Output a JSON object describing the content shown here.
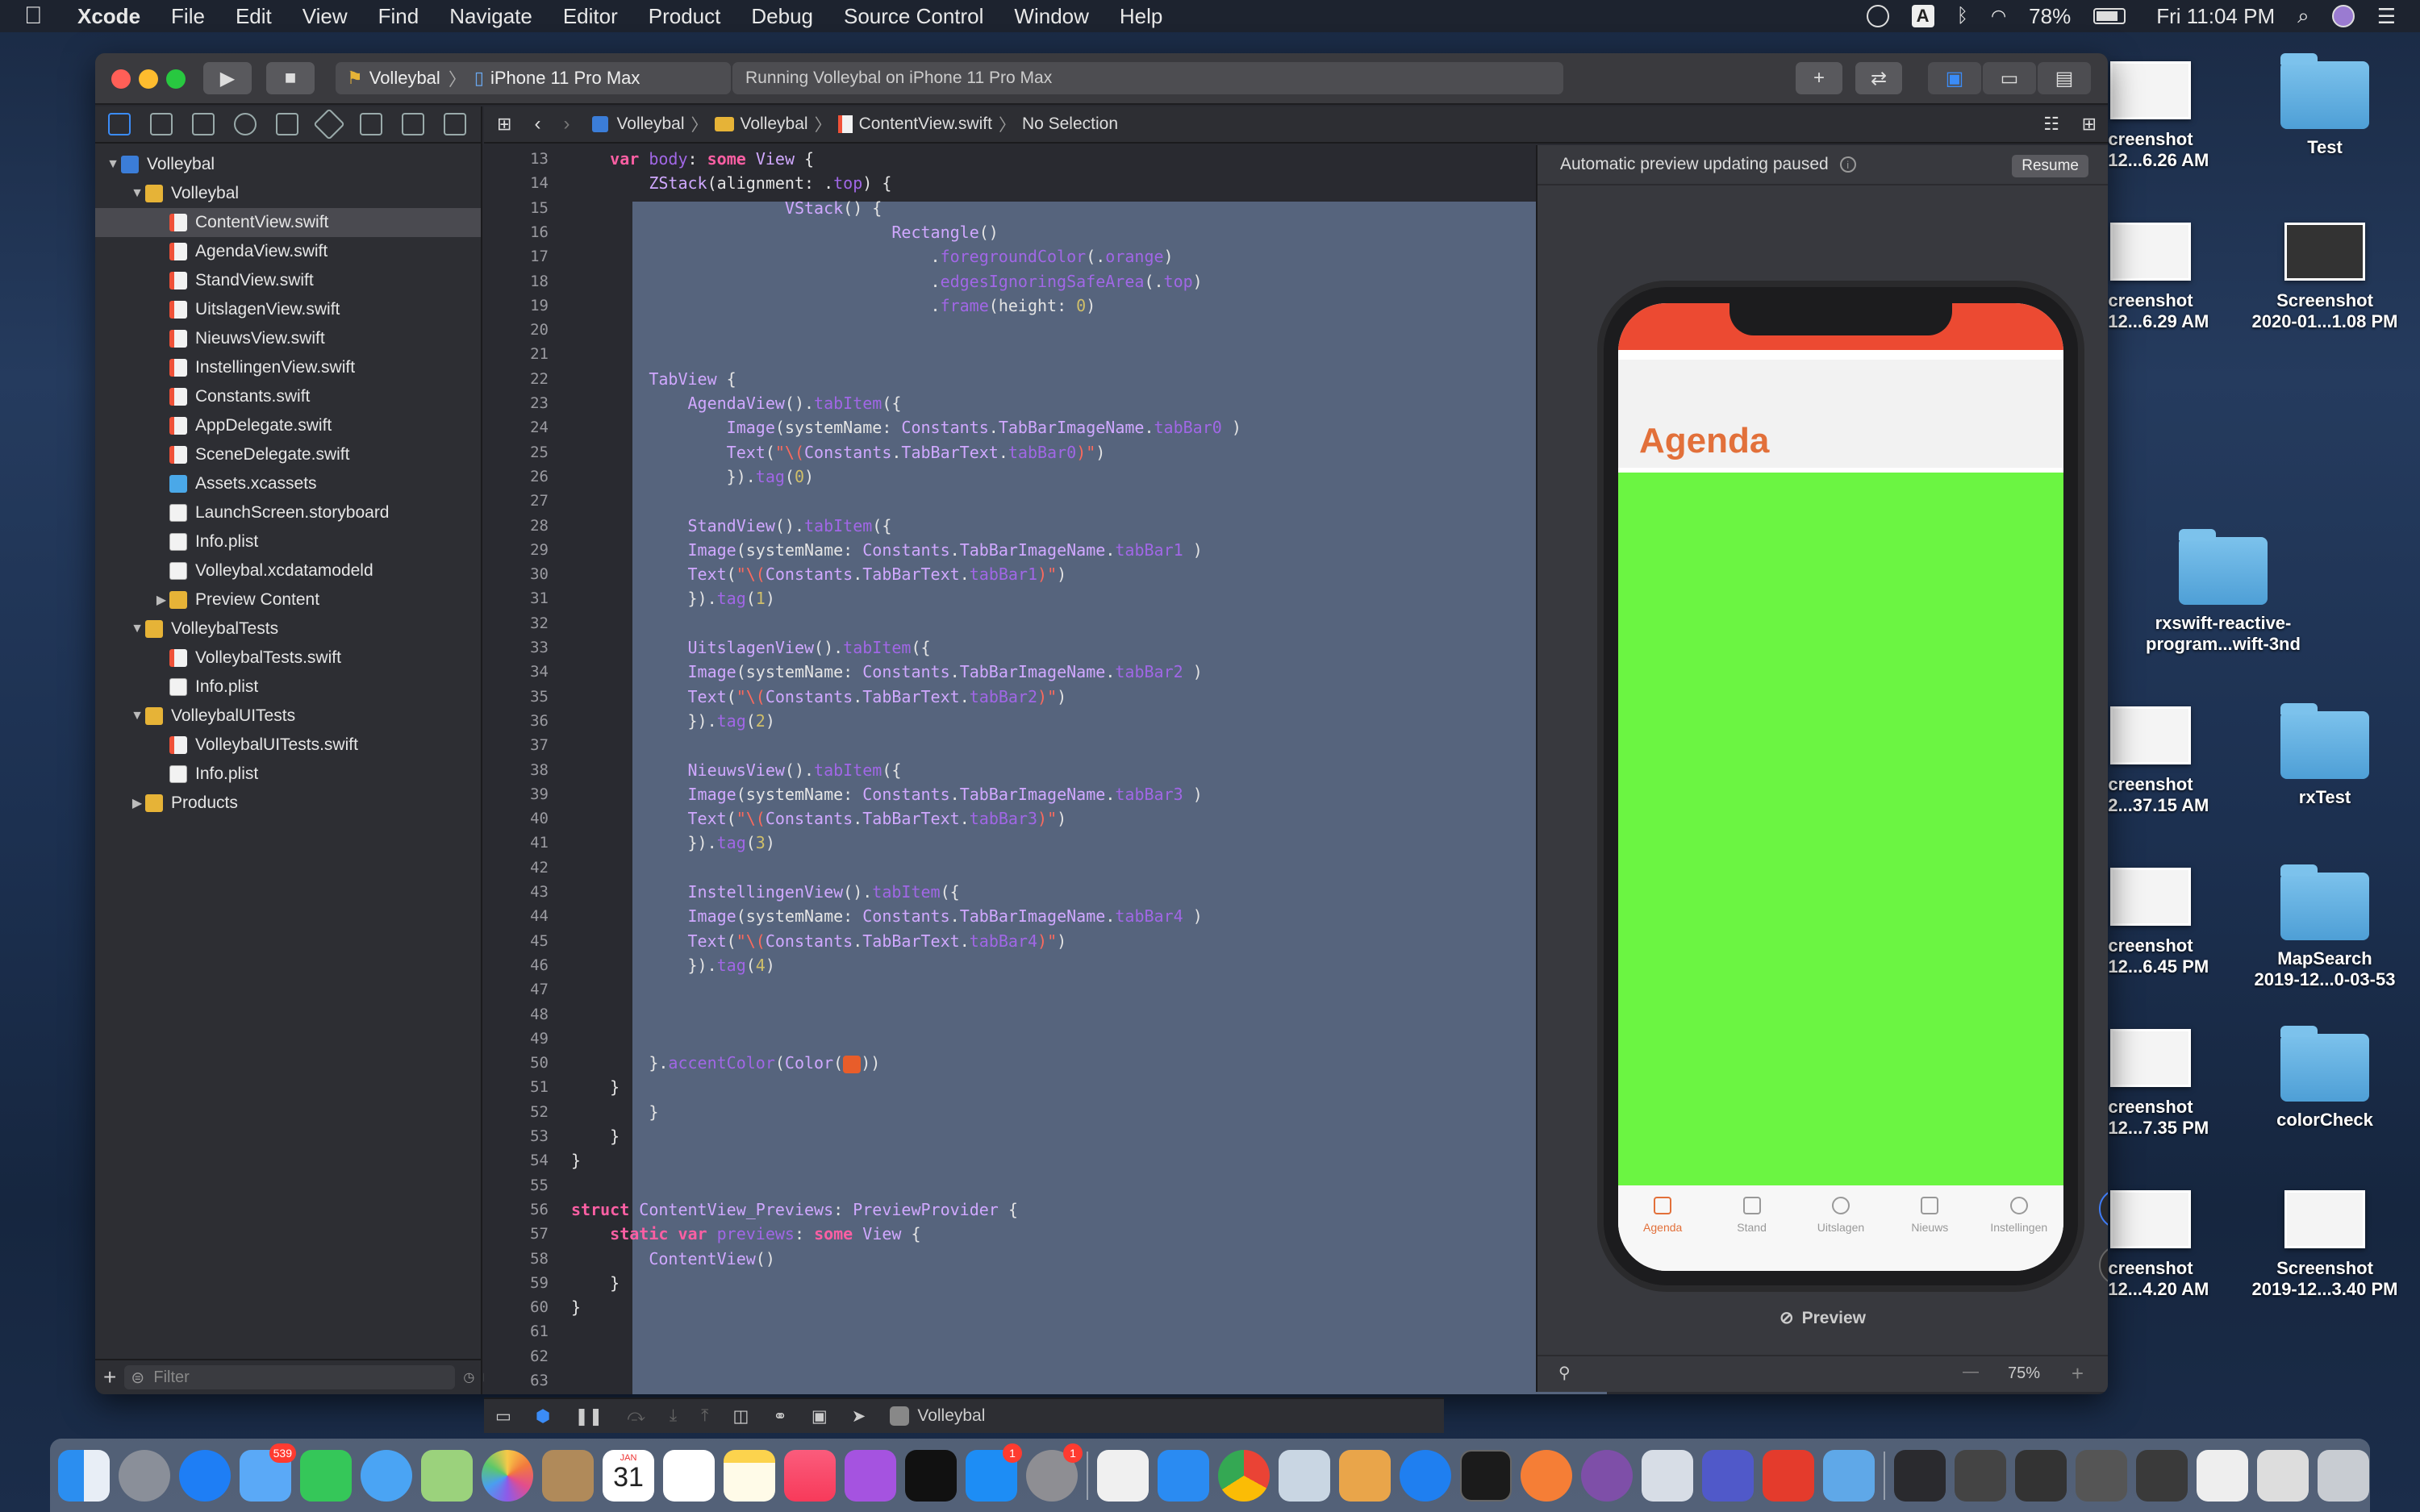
{
  "menubar": {
    "app_name": "Xcode",
    "menus": [
      "File",
      "Edit",
      "View",
      "Find",
      "Navigate",
      "Editor",
      "Product",
      "Debug",
      "Source Control",
      "Window",
      "Help"
    ],
    "battery": "78%",
    "clock": "Fri 11:04 PM",
    "input_source": "A"
  },
  "desktop": {
    "items": [
      {
        "label1": "creenshot",
        "label2": "0-12...6.26 AM",
        "kind": "thumb"
      },
      {
        "label1": "Test",
        "label2": "",
        "kind": "folder"
      },
      {
        "label1": "creenshot",
        "label2": "0-12...6.29 AM",
        "kind": "thumb"
      },
      {
        "label1": "Screenshot",
        "label2": "2020-01...1.08 PM",
        "kind": "thumb"
      },
      {
        "label1": "rxswift-reactive-",
        "label2": "program...wift-3nd",
        "kind": "folder"
      },
      {
        "label1": "creenshot",
        "label2": "-12...37.15 AM",
        "kind": "thumb"
      },
      {
        "label1": "rxTest",
        "label2": "",
        "kind": "folder"
      },
      {
        "label1": "creenshot",
        "label2": "0-12...6.45 PM",
        "kind": "thumb"
      },
      {
        "label1": "MapSearch",
        "label2": "2019-12...0-03-53",
        "kind": "folder"
      },
      {
        "label1": "creenshot",
        "label2": "9-12...7.35 PM",
        "kind": "thumb"
      },
      {
        "label1": "colorCheck",
        "label2": "",
        "kind": "folder"
      },
      {
        "label1": "creenshot",
        "label2": "0-12...4.20 AM",
        "kind": "thumb"
      },
      {
        "label1": "Screenshot",
        "label2": "2019-12...3.40 PM",
        "kind": "thumb"
      }
    ]
  },
  "toolbar": {
    "scheme": "Volleybal",
    "device": "iPhone 11 Pro Max",
    "status": "Running Volleybal on iPhone 11 Pro Max",
    "add_label": "+",
    "swap_label": "⇄"
  },
  "jumpbar": {
    "crumbs": [
      "Volleybal",
      "Volleybal",
      "ContentView.swift",
      "No Selection"
    ]
  },
  "navigator": {
    "rows": [
      {
        "label": "Volleybal",
        "indent": 0,
        "icon": "proj",
        "disc": "▼"
      },
      {
        "label": "Volleybal",
        "indent": 1,
        "icon": "fold",
        "disc": "▼"
      },
      {
        "label": "ContentView.swift",
        "indent": 2,
        "icon": "swift",
        "disc": "",
        "selected": true
      },
      {
        "label": "AgendaView.swift",
        "indent": 2,
        "icon": "swift",
        "disc": ""
      },
      {
        "label": "StandView.swift",
        "indent": 2,
        "icon": "swift",
        "disc": ""
      },
      {
        "label": "UitslagenView.swift",
        "indent": 2,
        "icon": "swift",
        "disc": ""
      },
      {
        "label": "NieuwsView.swift",
        "indent": 2,
        "icon": "swift",
        "disc": ""
      },
      {
        "label": "InstellingenView.swift",
        "indent": 2,
        "icon": "swift",
        "disc": ""
      },
      {
        "label": "Constants.swift",
        "indent": 2,
        "icon": "swift",
        "disc": ""
      },
      {
        "label": "AppDelegate.swift",
        "indent": 2,
        "icon": "swift",
        "disc": ""
      },
      {
        "label": "SceneDelegate.swift",
        "indent": 2,
        "icon": "swift",
        "disc": ""
      },
      {
        "label": "Assets.xcassets",
        "indent": 2,
        "icon": "assets",
        "disc": ""
      },
      {
        "label": "LaunchScreen.storyboard",
        "indent": 2,
        "icon": "file",
        "disc": ""
      },
      {
        "label": "Info.plist",
        "indent": 2,
        "icon": "file",
        "disc": ""
      },
      {
        "label": "Volleybal.xcdatamodeld",
        "indent": 2,
        "icon": "file",
        "disc": ""
      },
      {
        "label": "Preview Content",
        "indent": 2,
        "icon": "fold",
        "disc": "▶"
      },
      {
        "label": "VolleybalTests",
        "indent": 1,
        "icon": "fold",
        "disc": "▼"
      },
      {
        "label": "VolleybalTests.swift",
        "indent": 2,
        "icon": "swift",
        "disc": ""
      },
      {
        "label": "Info.plist",
        "indent": 2,
        "icon": "file",
        "disc": ""
      },
      {
        "label": "VolleybalUITests",
        "indent": 1,
        "icon": "fold",
        "disc": "▼"
      },
      {
        "label": "VolleybalUITests.swift",
        "indent": 2,
        "icon": "swift",
        "disc": ""
      },
      {
        "label": "Info.plist",
        "indent": 2,
        "icon": "file",
        "disc": ""
      },
      {
        "label": "Products",
        "indent": 1,
        "icon": "fold",
        "disc": "▶"
      }
    ],
    "filter_placeholder": "Filter"
  },
  "editor": {
    "lines": [
      {
        "n": "13",
        "html": "    <span class='kw'>var</span> <span class='fn'>body</span>: <span class='kw'>some</span> <span class='ty'>View</span> {"
      },
      {
        "n": "14",
        "html": "        <span class='ty'>ZStack</span>(alignment: .<span class='fn'>top</span>) {"
      },
      {
        "n": "15",
        "html": "                      <span class='ty'>VStack</span>() {"
      },
      {
        "n": "16",
        "html": "                                 <span class='ty'>Rectangle</span>()"
      },
      {
        "n": "17",
        "html": "                                     .<span class='fn'>foregroundColor</span>(.<span class='fn'>orange</span>)"
      },
      {
        "n": "18",
        "html": "                                     .<span class='fn'>edgesIgnoringSafeArea</span>(.<span class='fn'>top</span>)"
      },
      {
        "n": "19",
        "html": "                                     .<span class='fn'>frame</span>(height: <span class='nm'>0</span>)"
      },
      {
        "n": "20",
        "html": ""
      },
      {
        "n": "21",
        "html": ""
      },
      {
        "n": "22",
        "html": "        <span class='ty'>TabView</span> {"
      },
      {
        "n": "23",
        "html": "            <span class='ty'>AgendaView</span>().<span class='fn'>tabItem</span>({"
      },
      {
        "n": "24",
        "html": "                <span class='ty'>Image</span>(systemName: <span class='ty'>Constants</span>.<span class='ty'>TabBarImageName</span>.<span class='fn'>tabBar0</span> )"
      },
      {
        "n": "25",
        "html": "                <span class='ty'>Text</span>(<span class='st'>\"\\(</span><span class='ty'>Constants</span>.<span class='ty'>TabBarText</span>.<span class='fn'>tabBar0</span><span class='st'>)\"</span>)"
      },
      {
        "n": "26",
        "html": "                }).<span class='fn'>tag</span>(<span class='nm'>0</span>)"
      },
      {
        "n": "27",
        "html": ""
      },
      {
        "n": "28",
        "html": "            <span class='ty'>StandView</span>().<span class='fn'>tabItem</span>({"
      },
      {
        "n": "29",
        "html": "            <span class='ty'>Image</span>(systemName: <span class='ty'>Constants</span>.<span class='ty'>TabBarImageName</span>.<span class='fn'>tabBar1</span> )"
      },
      {
        "n": "30",
        "html": "            <span class='ty'>Text</span>(<span class='st'>\"\\(</span><span class='ty'>Constants</span>.<span class='ty'>TabBarText</span>.<span class='fn'>tabBar1</span><span class='st'>)\"</span>)"
      },
      {
        "n": "31",
        "html": "            }).<span class='fn'>tag</span>(<span class='nm'>1</span>)"
      },
      {
        "n": "32",
        "html": ""
      },
      {
        "n": "33",
        "html": "            <span class='ty'>UitslagenView</span>().<span class='fn'>tabItem</span>({"
      },
      {
        "n": "34",
        "html": "            <span class='ty'>Image</span>(systemName: <span class='ty'>Constants</span>.<span class='ty'>TabBarImageName</span>.<span class='fn'>tabBar2</span> )"
      },
      {
        "n": "35",
        "html": "            <span class='ty'>Text</span>(<span class='st'>\"\\(</span><span class='ty'>Constants</span>.<span class='ty'>TabBarText</span>.<span class='fn'>tabBar2</span><span class='st'>)\"</span>)"
      },
      {
        "n": "36",
        "html": "            }).<span class='fn'>tag</span>(<span class='nm'>2</span>)"
      },
      {
        "n": "37",
        "html": ""
      },
      {
        "n": "38",
        "html": "            <span class='ty'>NieuwsView</span>().<span class='fn'>tabItem</span>({"
      },
      {
        "n": "39",
        "html": "            <span class='ty'>Image</span>(systemName: <span class='ty'>Constants</span>.<span class='ty'>TabBarImageName</span>.<span class='fn'>tabBar3</span> )"
      },
      {
        "n": "40",
        "html": "            <span class='ty'>Text</span>(<span class='st'>\"\\(</span><span class='ty'>Constants</span>.<span class='ty'>TabBarText</span>.<span class='fn'>tabBar3</span><span class='st'>)\"</span>)"
      },
      {
        "n": "41",
        "html": "            }).<span class='fn'>tag</span>(<span class='nm'>3</span>)"
      },
      {
        "n": "42",
        "html": ""
      },
      {
        "n": "43",
        "html": "            <span class='ty'>InstellingenView</span>().<span class='fn'>tabItem</span>({"
      },
      {
        "n": "44",
        "html": "            <span class='ty'>Image</span>(systemName: <span class='ty'>Constants</span>.<span class='ty'>TabBarImageName</span>.<span class='fn'>tabBar4</span> )"
      },
      {
        "n": "45",
        "html": "            <span class='ty'>Text</span>(<span class='st'>\"\\(</span><span class='ty'>Constants</span>.<span class='ty'>TabBarText</span>.<span class='fn'>tabBar4</span><span class='st'>)\"</span>)"
      },
      {
        "n": "46",
        "html": "            }).<span class='fn'>tag</span>(<span class='nm'>4</span>)"
      },
      {
        "n": "47",
        "html": ""
      },
      {
        "n": "48",
        "html": ""
      },
      {
        "n": "49",
        "html": ""
      },
      {
        "n": "50",
        "html": "        }.<span class='fn'>accentColor</span>(<span class='ty'>Color</span>(<span class='swatch'></span>))"
      },
      {
        "n": "51",
        "html": "    }"
      },
      {
        "n": "52",
        "html": "        }"
      },
      {
        "n": "53",
        "html": "    }"
      },
      {
        "n": "54",
        "html": "}"
      },
      {
        "n": "55",
        "html": ""
      },
      {
        "n": "56",
        "html": "<span class='kw'>struct</span> <span class='ty'>ContentView_Previews</span>: <span class='ty'>PreviewProvider</span> {"
      },
      {
        "n": "57",
        "html": "    <span class='kw'>static var</span> <span class='fn'>previews</span>: <span class='kw'>some</span> <span class='ty'>View</span> {"
      },
      {
        "n": "58",
        "html": "        <span class='ty'>ContentView</span>()"
      },
      {
        "n": "59",
        "html": "    }"
      },
      {
        "n": "60",
        "html": "}"
      },
      {
        "n": "61",
        "html": ""
      },
      {
        "n": "62",
        "html": ""
      },
      {
        "n": "63",
        "html": ""
      }
    ]
  },
  "canvas": {
    "header": "Automatic preview updating paused",
    "resume": "Resume",
    "app_title": "Agenda",
    "tabs": [
      "Agenda",
      "Stand",
      "Uitslagen",
      "Nieuws",
      "Instellingen"
    ],
    "preview_label": "Preview",
    "zoom": "75%",
    "zoom_minus": "—",
    "zoom_plus": "+"
  },
  "debugbar": {
    "target": "Volleybal"
  },
  "dock": {
    "mail_badge": "539",
    "appstore_badge": "1",
    "prefs_badge": "1",
    "calendar_day": "31",
    "calendar_month": "JAN"
  }
}
